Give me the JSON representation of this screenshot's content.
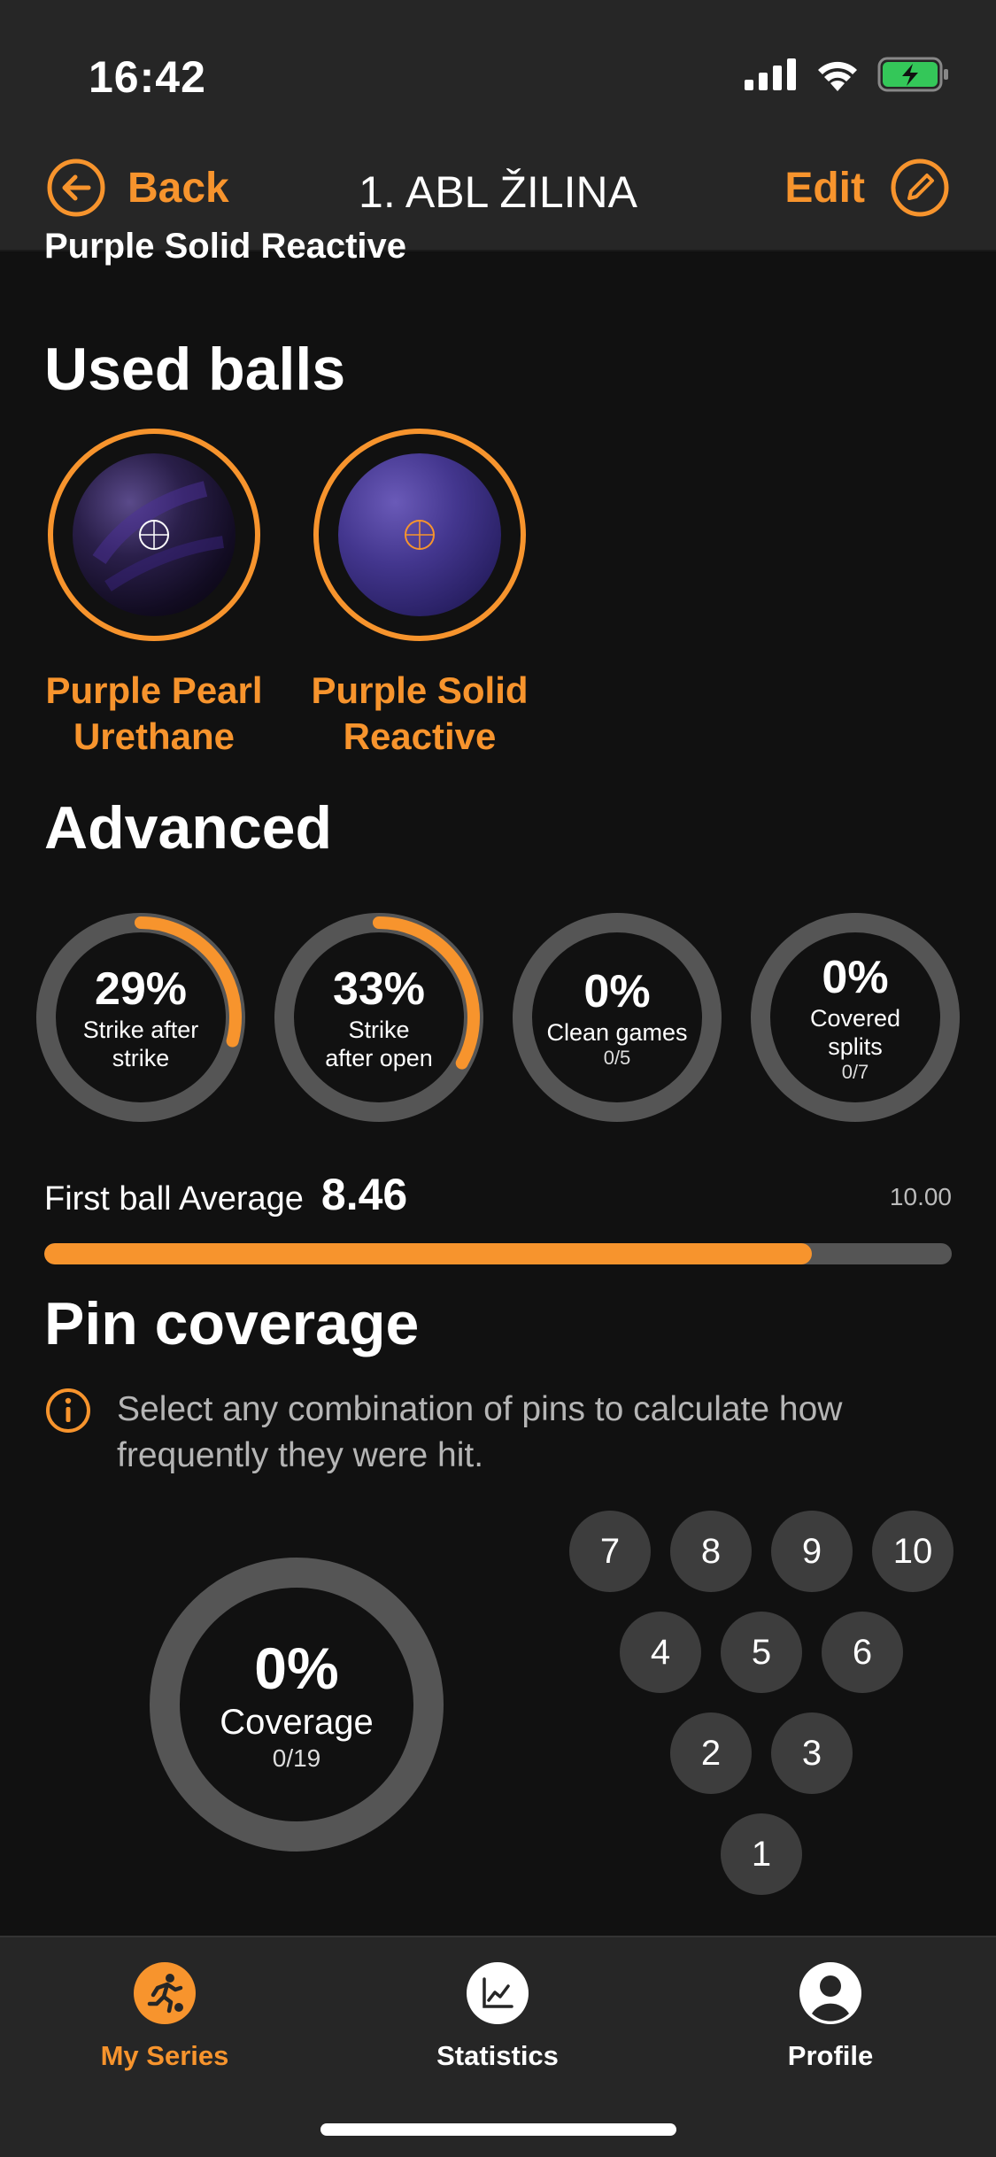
{
  "status_bar": {
    "time": "16:42"
  },
  "nav": {
    "back_label": "Back",
    "title": "1. ABL ŽILINA",
    "edit_label": "Edit"
  },
  "cut_off_title": "Purple Solid Reactive",
  "used_balls": {
    "title": "Used balls",
    "balls": [
      {
        "line1": "Purple Pearl",
        "line2": "Urethane"
      },
      {
        "line1": "Purple Solid",
        "line2": "Reactive"
      }
    ]
  },
  "advanced": {
    "title": "Advanced",
    "stats": [
      {
        "value": "29%",
        "label1": "Strike after",
        "label2": "strike",
        "sub": "",
        "progress": 0.29
      },
      {
        "value": "33%",
        "label1": "Strike",
        "label2": "after open",
        "sub": "",
        "progress": 0.33
      },
      {
        "value": "0%",
        "label1": "Clean games",
        "label2": "",
        "sub": "0/5",
        "progress": 0
      },
      {
        "value": "0%",
        "label1": "Covered",
        "label2": "splits",
        "sub": "0/7",
        "progress": 0
      }
    ],
    "first_ball": {
      "label": "First ball Average",
      "value": "8.46",
      "max": "10.00",
      "fraction": 0.846
    }
  },
  "pin_coverage": {
    "title": "Pin coverage",
    "info": "Select any combination of pins to calculate how frequently they were hit.",
    "coverage_value": "0%",
    "coverage_label": "Coverage",
    "coverage_sub": "0/19",
    "pins": [
      "7",
      "8",
      "9",
      "10",
      "4",
      "5",
      "6",
      "2",
      "3",
      "1"
    ]
  },
  "tabs": [
    {
      "label": "My Series",
      "icon": "bowler-icon",
      "active": true
    },
    {
      "label": "Statistics",
      "icon": "chart-icon",
      "active": false
    },
    {
      "label": "Profile",
      "icon": "person-icon",
      "active": false
    }
  ],
  "colors": {
    "accent": "#f7942d",
    "background": "#111111",
    "bar_background": "#262626",
    "ring_track": "#555555",
    "pin": "#3d3d3d"
  }
}
